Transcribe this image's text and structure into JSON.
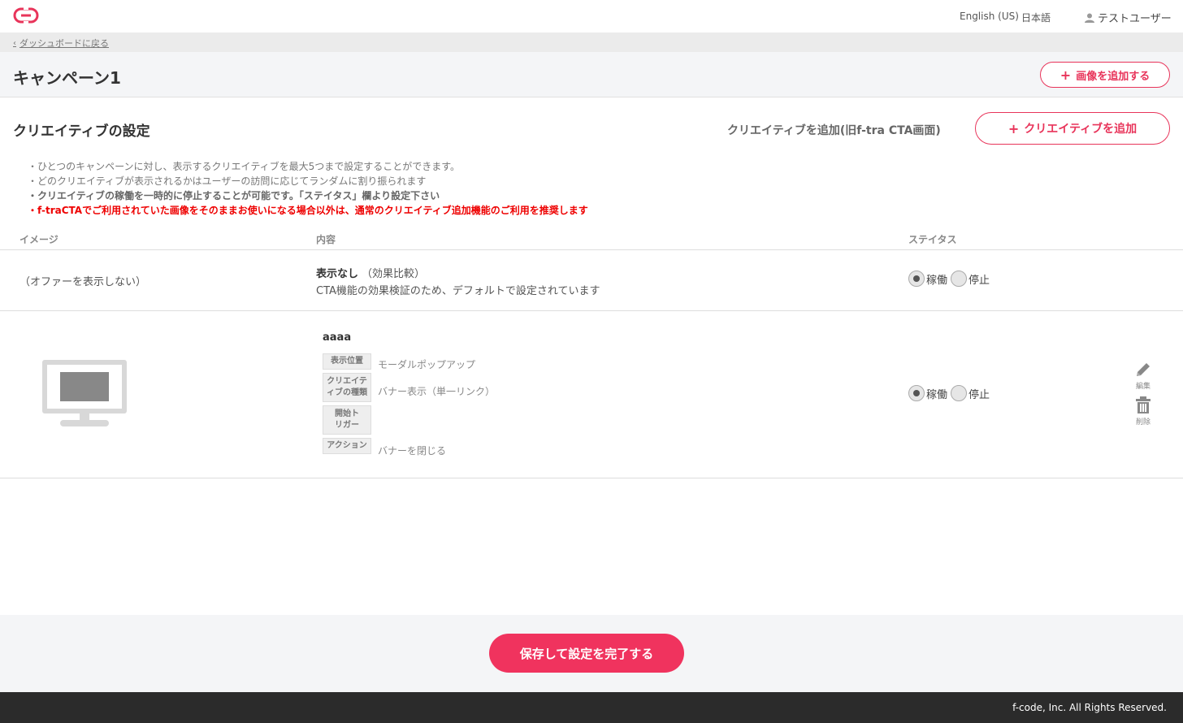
{
  "header": {
    "logo_icon": "link-icon",
    "lang_en": "English (US)",
    "lang_ja": "日本語",
    "user_name": "テストユーザー",
    "brand_color": "#e8345a"
  },
  "breadcrumb": {
    "back_label": "ダッシュボードに戻る"
  },
  "campaign": {
    "title": "キャンペーン1",
    "add_image_label": "画像を追加する"
  },
  "creatives": {
    "section_title": "クリエイティブの設定",
    "legacy_add_label": "クリエイティブを追加(旧f-tra CTA画面)",
    "add_label": "クリエイティブを追加",
    "notes": [
      "・ひとつのキャンペーンに対し、表示するクリエイティブを最大5つまで設定することができます。",
      "・どのクリエイティブが表示されるかはユーザーの訪問に応じてランダムに割り振られます",
      "・クリエイティブの稼働を一時的に停止することが可能です。「ステイタス」欄より設定下さい",
      "・f-traCTAでご利用されていた画像をそのままお使いになる場合以外は、通常のクリエイティブ追加機能のご利用を推奨します"
    ],
    "columns": {
      "image": "イメージ",
      "content": "内容",
      "status": "ステイタス"
    },
    "status_options": {
      "active": "稼働",
      "stopped": "停止"
    },
    "rows": [
      {
        "image_text": "（オファーを表示しない）",
        "title": "表示なし",
        "title_sub": "（効果比較）",
        "description": "CTA機能の効果検証のため、デフォルトで設定されています",
        "status": "active"
      },
      {
        "name": "aaaa",
        "fields": [
          {
            "label": "表示位置",
            "value": "モーダルポップアップ"
          },
          {
            "label": "クリエイティブの種類",
            "value": "バナー表示（単一リンク）"
          },
          {
            "label": "開始トリガー",
            "value": ""
          },
          {
            "label": "アクション",
            "value": "バナーを閉じる"
          }
        ],
        "status": "active",
        "edit_label": "編集",
        "delete_label": "削除"
      }
    ]
  },
  "save": {
    "label": "保存して設定を完了する"
  },
  "footer": {
    "copyright": "f-code, Inc. All Rights Reserved."
  }
}
